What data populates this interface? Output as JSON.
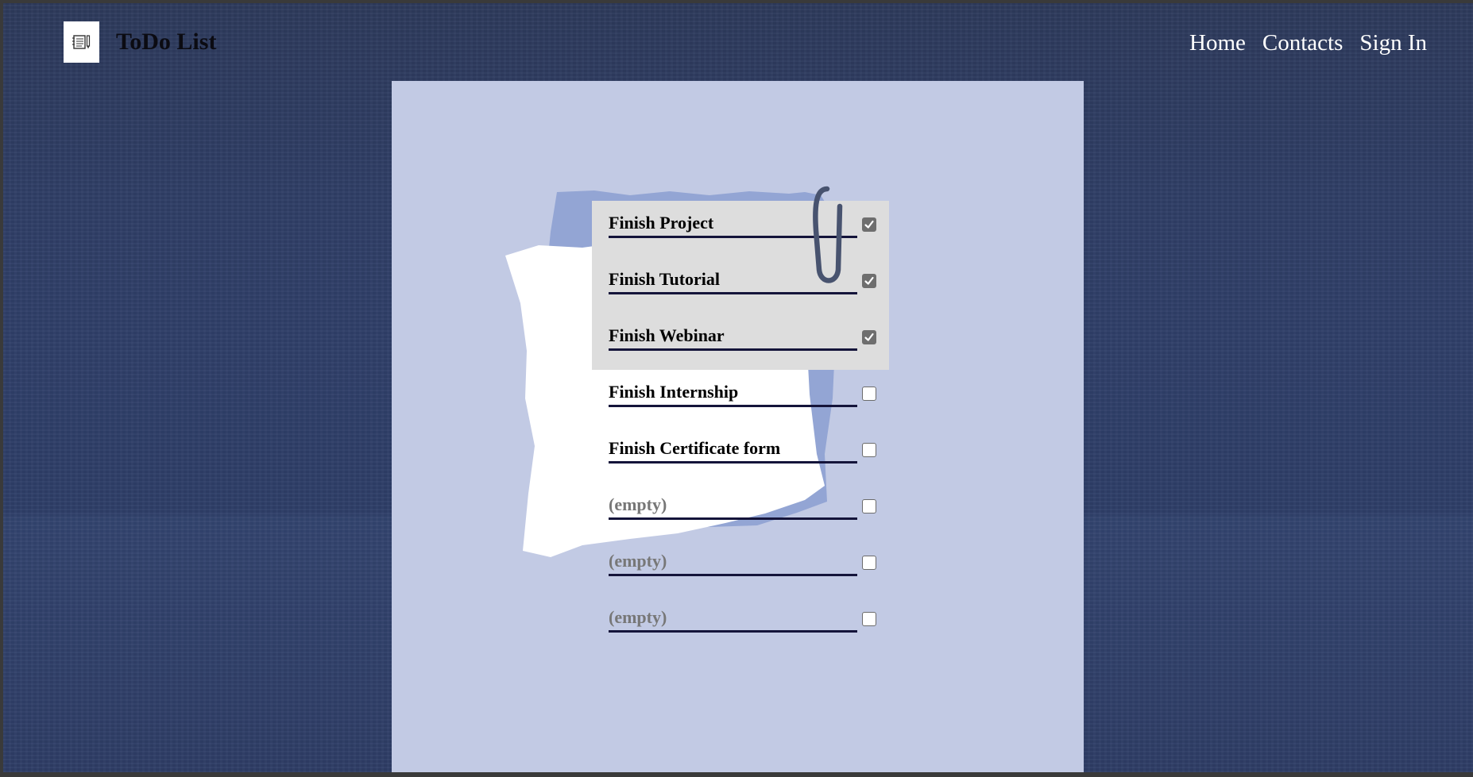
{
  "app": {
    "title": "ToDo List",
    "logo_icon": "notepad-pencil-icon"
  },
  "nav": {
    "items": [
      "Home",
      "Contacts",
      "Sign In"
    ]
  },
  "todos": [
    {
      "text": "Finish Project",
      "checked": true
    },
    {
      "text": "Finish Tutorial",
      "checked": true
    },
    {
      "text": "Finish Webinar",
      "checked": true
    },
    {
      "text": "Finish Internship",
      "checked": false
    },
    {
      "text": "Finish Certificate form",
      "checked": false
    },
    {
      "text": "(empty)",
      "checked": false,
      "placeholder": true
    },
    {
      "text": "(empty)",
      "checked": false,
      "placeholder": true
    },
    {
      "text": "(empty)",
      "checked": false,
      "placeholder": true
    }
  ],
  "colors": {
    "background": "#2f3f69",
    "card": "#c2cae4",
    "paper_back": "#93a5d4",
    "paper_front": "#ffffff",
    "completed_highlight": "#dddddd",
    "underline": "#14143a"
  }
}
